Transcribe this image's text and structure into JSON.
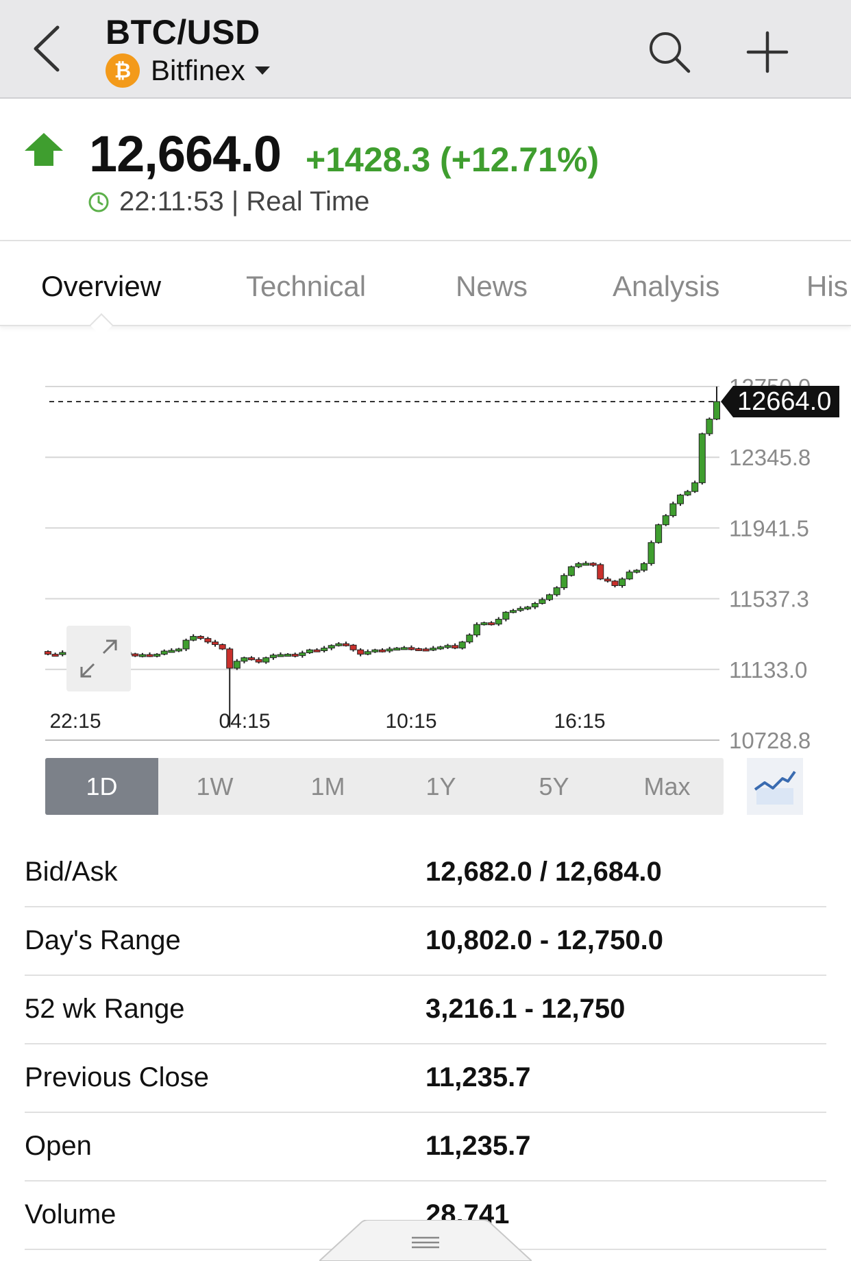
{
  "header": {
    "pair": "BTC/USD",
    "exchange": "Bitfinex",
    "coin_symbol": "₿"
  },
  "quote": {
    "price": "12,664.0",
    "change": "+1428.3 (+12.71%)",
    "time": "22:11:53 | Real Time",
    "up_color": "#3f9e2f",
    "down_color": "#c9302c"
  },
  "tabs": [
    "Overview",
    "Technical",
    "News",
    "Analysis",
    "His"
  ],
  "chart": {
    "last_price_label": "12664.0"
  },
  "chart_data": {
    "type": "candlestick",
    "y_ticks": [
      "12750.0",
      "12345.8",
      "11941.5",
      "11537.3",
      "11133.0",
      "10728.8"
    ],
    "ylim": [
      10728.8,
      12750.0
    ],
    "x_ticks": [
      "22:15",
      "04:15",
      "10:15",
      "16:15"
    ],
    "last_price": 12664.0,
    "grid": true,
    "close_series": [
      11220,
      11218,
      11230,
      11226,
      11262,
      11248,
      11235,
      11240,
      11255,
      11250,
      11230,
      11222,
      11210,
      11218,
      11214,
      11220,
      11238,
      11242,
      11250,
      11300,
      11322,
      11310,
      11290,
      11275,
      11250,
      11140,
      11180,
      11200,
      11190,
      11175,
      11200,
      11215,
      11218,
      11220,
      11212,
      11228,
      11245,
      11240,
      11255,
      11270,
      11280,
      11272,
      11245,
      11220,
      11235,
      11245,
      11240,
      11250,
      11255,
      11258,
      11252,
      11250,
      11246,
      11255,
      11262,
      11270,
      11255,
      11290,
      11330,
      11390,
      11400,
      11392,
      11420,
      11460,
      11470,
      11482,
      11490,
      11510,
      11532,
      11560,
      11600,
      11670,
      11720,
      11738,
      11740,
      11732,
      11650,
      11638,
      11612,
      11650,
      11690,
      11700,
      11738,
      11858,
      11960,
      12012,
      12080,
      12130,
      12150,
      12200,
      12480,
      12564,
      12664
    ]
  },
  "ranges": [
    "1D",
    "1W",
    "1M",
    "1Y",
    "5Y",
    "Max"
  ],
  "stats": [
    {
      "label": "Bid/Ask",
      "value": "12,682.0 / 12,684.0"
    },
    {
      "label": "Day's Range",
      "value": "10,802.0 - 12,750.0"
    },
    {
      "label": "52 wk Range",
      "value": "3,216.1 - 12,750"
    },
    {
      "label": "Previous Close",
      "value": "11,235.7"
    },
    {
      "label": "Open",
      "value": "11,235.7"
    },
    {
      "label": "Volume",
      "value": "28,741"
    }
  ]
}
